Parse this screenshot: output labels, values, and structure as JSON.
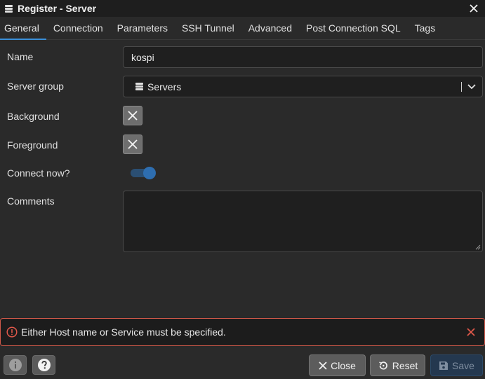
{
  "window": {
    "title": "Register - Server"
  },
  "tabs": [
    {
      "label": "General"
    },
    {
      "label": "Connection"
    },
    {
      "label": "Parameters"
    },
    {
      "label": "SSH Tunnel"
    },
    {
      "label": "Advanced"
    },
    {
      "label": "Post Connection SQL"
    },
    {
      "label": "Tags"
    }
  ],
  "active_tab": "General",
  "form": {
    "name": {
      "label": "Name",
      "value": "kospi"
    },
    "server_group": {
      "label": "Server group",
      "value": "Servers"
    },
    "background": {
      "label": "Background"
    },
    "foreground": {
      "label": "Foreground"
    },
    "connect_now": {
      "label": "Connect now?",
      "checked": true
    },
    "comments": {
      "label": "Comments",
      "value": ""
    }
  },
  "error": {
    "message": "Either Host name or Service must be specified."
  },
  "footer": {
    "close_label": "Close",
    "reset_label": "Reset",
    "save_label": "Save"
  },
  "colors": {
    "accent": "#3a8fd8",
    "error_border": "#d35a4a",
    "toggle_on": "#2e6eb0",
    "save_disabled_bg": "#24384f"
  },
  "icons": {
    "title": "server-group-icon",
    "info": "info-icon",
    "help": "help-icon",
    "close": "close-icon",
    "reset": "reset-icon",
    "save": "save-icon",
    "error": "error-circle-icon"
  }
}
